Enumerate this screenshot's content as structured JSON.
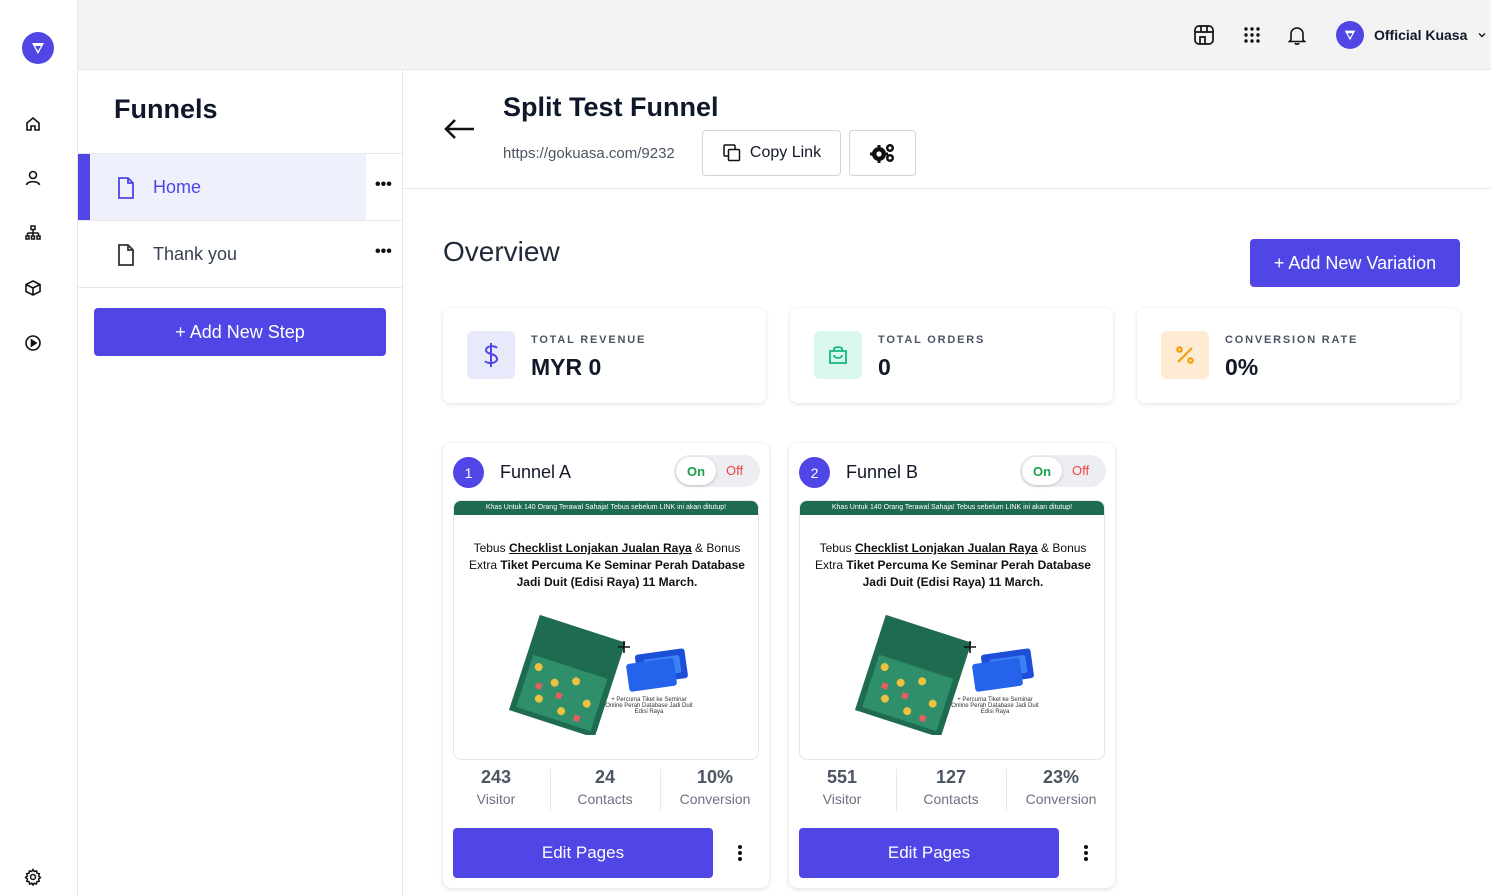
{
  "app": {
    "account_name": "Official Kuasa",
    "accent_color": "#4f46e5"
  },
  "topbar": {
    "icons": [
      "store-icon",
      "apps-grid-icon",
      "bell-icon"
    ]
  },
  "rail": {
    "icons": [
      "home-icon",
      "user-icon",
      "org-chart-icon",
      "box-icon",
      "play-icon",
      "settings-icon"
    ]
  },
  "steps_panel": {
    "title": "Funnels",
    "items": [
      {
        "label": "Home",
        "active": true
      },
      {
        "label": "Thank you",
        "active": false
      }
    ],
    "more_label": "•••",
    "add_step_label": "+ Add New Step"
  },
  "header": {
    "title": "Split Test Funnel",
    "url": "https://gokuasa.com/9232",
    "copy_link_label": "Copy Link"
  },
  "overview": {
    "title": "Overview",
    "add_variation_label": "+ Add New Variation",
    "stats": [
      {
        "label": "TOTAL REVENUE",
        "value": "MYR 0",
        "icon": "dollar-icon",
        "icon_color": "#4f46e5",
        "bg_color": "#e8e9fb"
      },
      {
        "label": "TOTAL ORDERS",
        "value": "0",
        "icon": "shopping-bag-icon",
        "icon_color": "#10b981",
        "bg_color": "#d9f7ec"
      },
      {
        "label": "CONVERSION RATE",
        "value": "0%",
        "icon": "percent-icon",
        "icon_color": "#f59e0b",
        "bg_color": "#fdecd3"
      }
    ]
  },
  "funnels": [
    {
      "number": "1",
      "name": "Funnel A",
      "toggle_on": "On",
      "toggle_off": "Off",
      "banner": "Khas Untuk 140 Orang Terawal Sahaja! Tebus sebelum LINK ini akan ditutup!",
      "text_pre": "Tebus",
      "text_link": "Checklist Lonjakan Jualan Raya",
      "text_mid": "& Bonus Extra",
      "text_bold": "Tiket Percuma Ke Seminar Perah Database Jadi Duit (Edisi Raya) 11 March.",
      "bonus_caption": "+ Percuma Tiket ke Seminar Online Perah Database Jadi Duit Edisi Raya",
      "visitors": "243",
      "visitors_label": "Visitor",
      "contacts": "24",
      "contacts_label": "Contacts",
      "conversion": "10%",
      "conversion_label": "Conversion",
      "edit_label": "Edit Pages"
    },
    {
      "number": "2",
      "name": "Funnel B",
      "toggle_on": "On",
      "toggle_off": "Off",
      "banner": "Khas Untuk 140 Orang Terawal Sahaja! Tebus sebelum LINK ini akan ditutup!",
      "text_pre": "Tebus",
      "text_link": "Checklist Lonjakan Jualan Raya",
      "text_mid": "& Bonus Extra",
      "text_bold": "Tiket Percuma Ke Seminar Perah Database Jadi Duit (Edisi Raya) 11 March.",
      "bonus_caption": "+ Percuma Tiket ke Seminar Online Perah Database Jadi Duit Edisi Raya",
      "visitors": "551",
      "visitors_label": "Visitor",
      "contacts": "127",
      "contacts_label": "Contacts",
      "conversion": "23%",
      "conversion_label": "Conversion",
      "edit_label": "Edit Pages"
    }
  ]
}
